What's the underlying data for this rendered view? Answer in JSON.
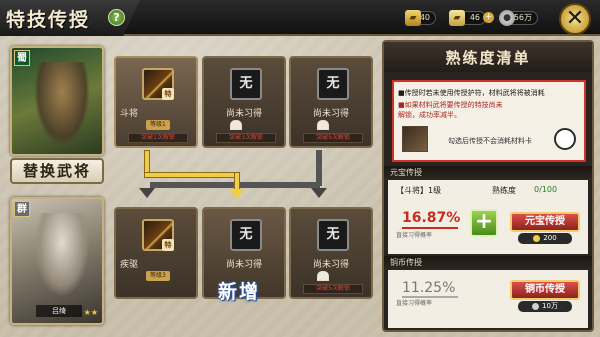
{
  "header": {
    "title": "特技传授",
    "resources": [
      {
        "icon": "gold-ingot-icon",
        "value": "40"
      },
      {
        "icon": "gold-bar-icon",
        "value": "46"
      },
      {
        "icon": "copper-coin-icon",
        "value": "1356万"
      }
    ]
  },
  "generals": {
    "top": {
      "faction": "蜀",
      "name": "",
      "stars": ""
    },
    "bottom": {
      "faction": "群",
      "name": "吕绮",
      "stars": "★★"
    },
    "swap_label": "替换武将"
  },
  "source_slots": [
    {
      "icon_text": "",
      "name": "斗将",
      "level": "等级1",
      "unlock": "突破1次解锁",
      "state": "learned"
    },
    {
      "icon_text": "无",
      "name": "尚未习得",
      "level": "",
      "unlock": "突破3次解锁",
      "state": "locked"
    },
    {
      "icon_text": "无",
      "name": "尚未习得",
      "level": "",
      "unlock": "突破5次解锁",
      "state": "locked"
    }
  ],
  "target_slots": [
    {
      "icon_text": "",
      "name": "疾驱",
      "level": "等级3",
      "unlock": "",
      "state": "learned"
    },
    {
      "icon_text": "无",
      "name": "尚未习得",
      "badge": "新增",
      "state": "new"
    },
    {
      "icon_text": "无",
      "name": "尚未习得",
      "level": "",
      "unlock": "突破5次解锁",
      "state": "locked"
    }
  ],
  "panel": {
    "title": "熟练度清单",
    "info_lines": [
      "■传授时若未使用传授护符，材料武将将被消耗",
      "■如果材料武将要传授的特技尚未",
      "解锁，成功率减半。"
    ],
    "consume_label": "勾选后传授不会消耗材料卡",
    "yuanbao": {
      "section": "元宝传授",
      "skill_level": "【斗将】1级",
      "proficiency_label": "熟练度",
      "proficiency_value": "0/100",
      "rate": "16.87%",
      "rate_label": "直接习得概率",
      "button": "元宝传授",
      "cost": "200"
    },
    "copper": {
      "section": "铜币传授",
      "rate": "11.25%",
      "rate_label": "直接习得概率",
      "button": "铜币传授",
      "cost": "10万"
    }
  },
  "colors": {
    "accent_red": "#c52d21",
    "accent_gold": "#f0cd48",
    "plus_green": "#4a8a1c"
  }
}
